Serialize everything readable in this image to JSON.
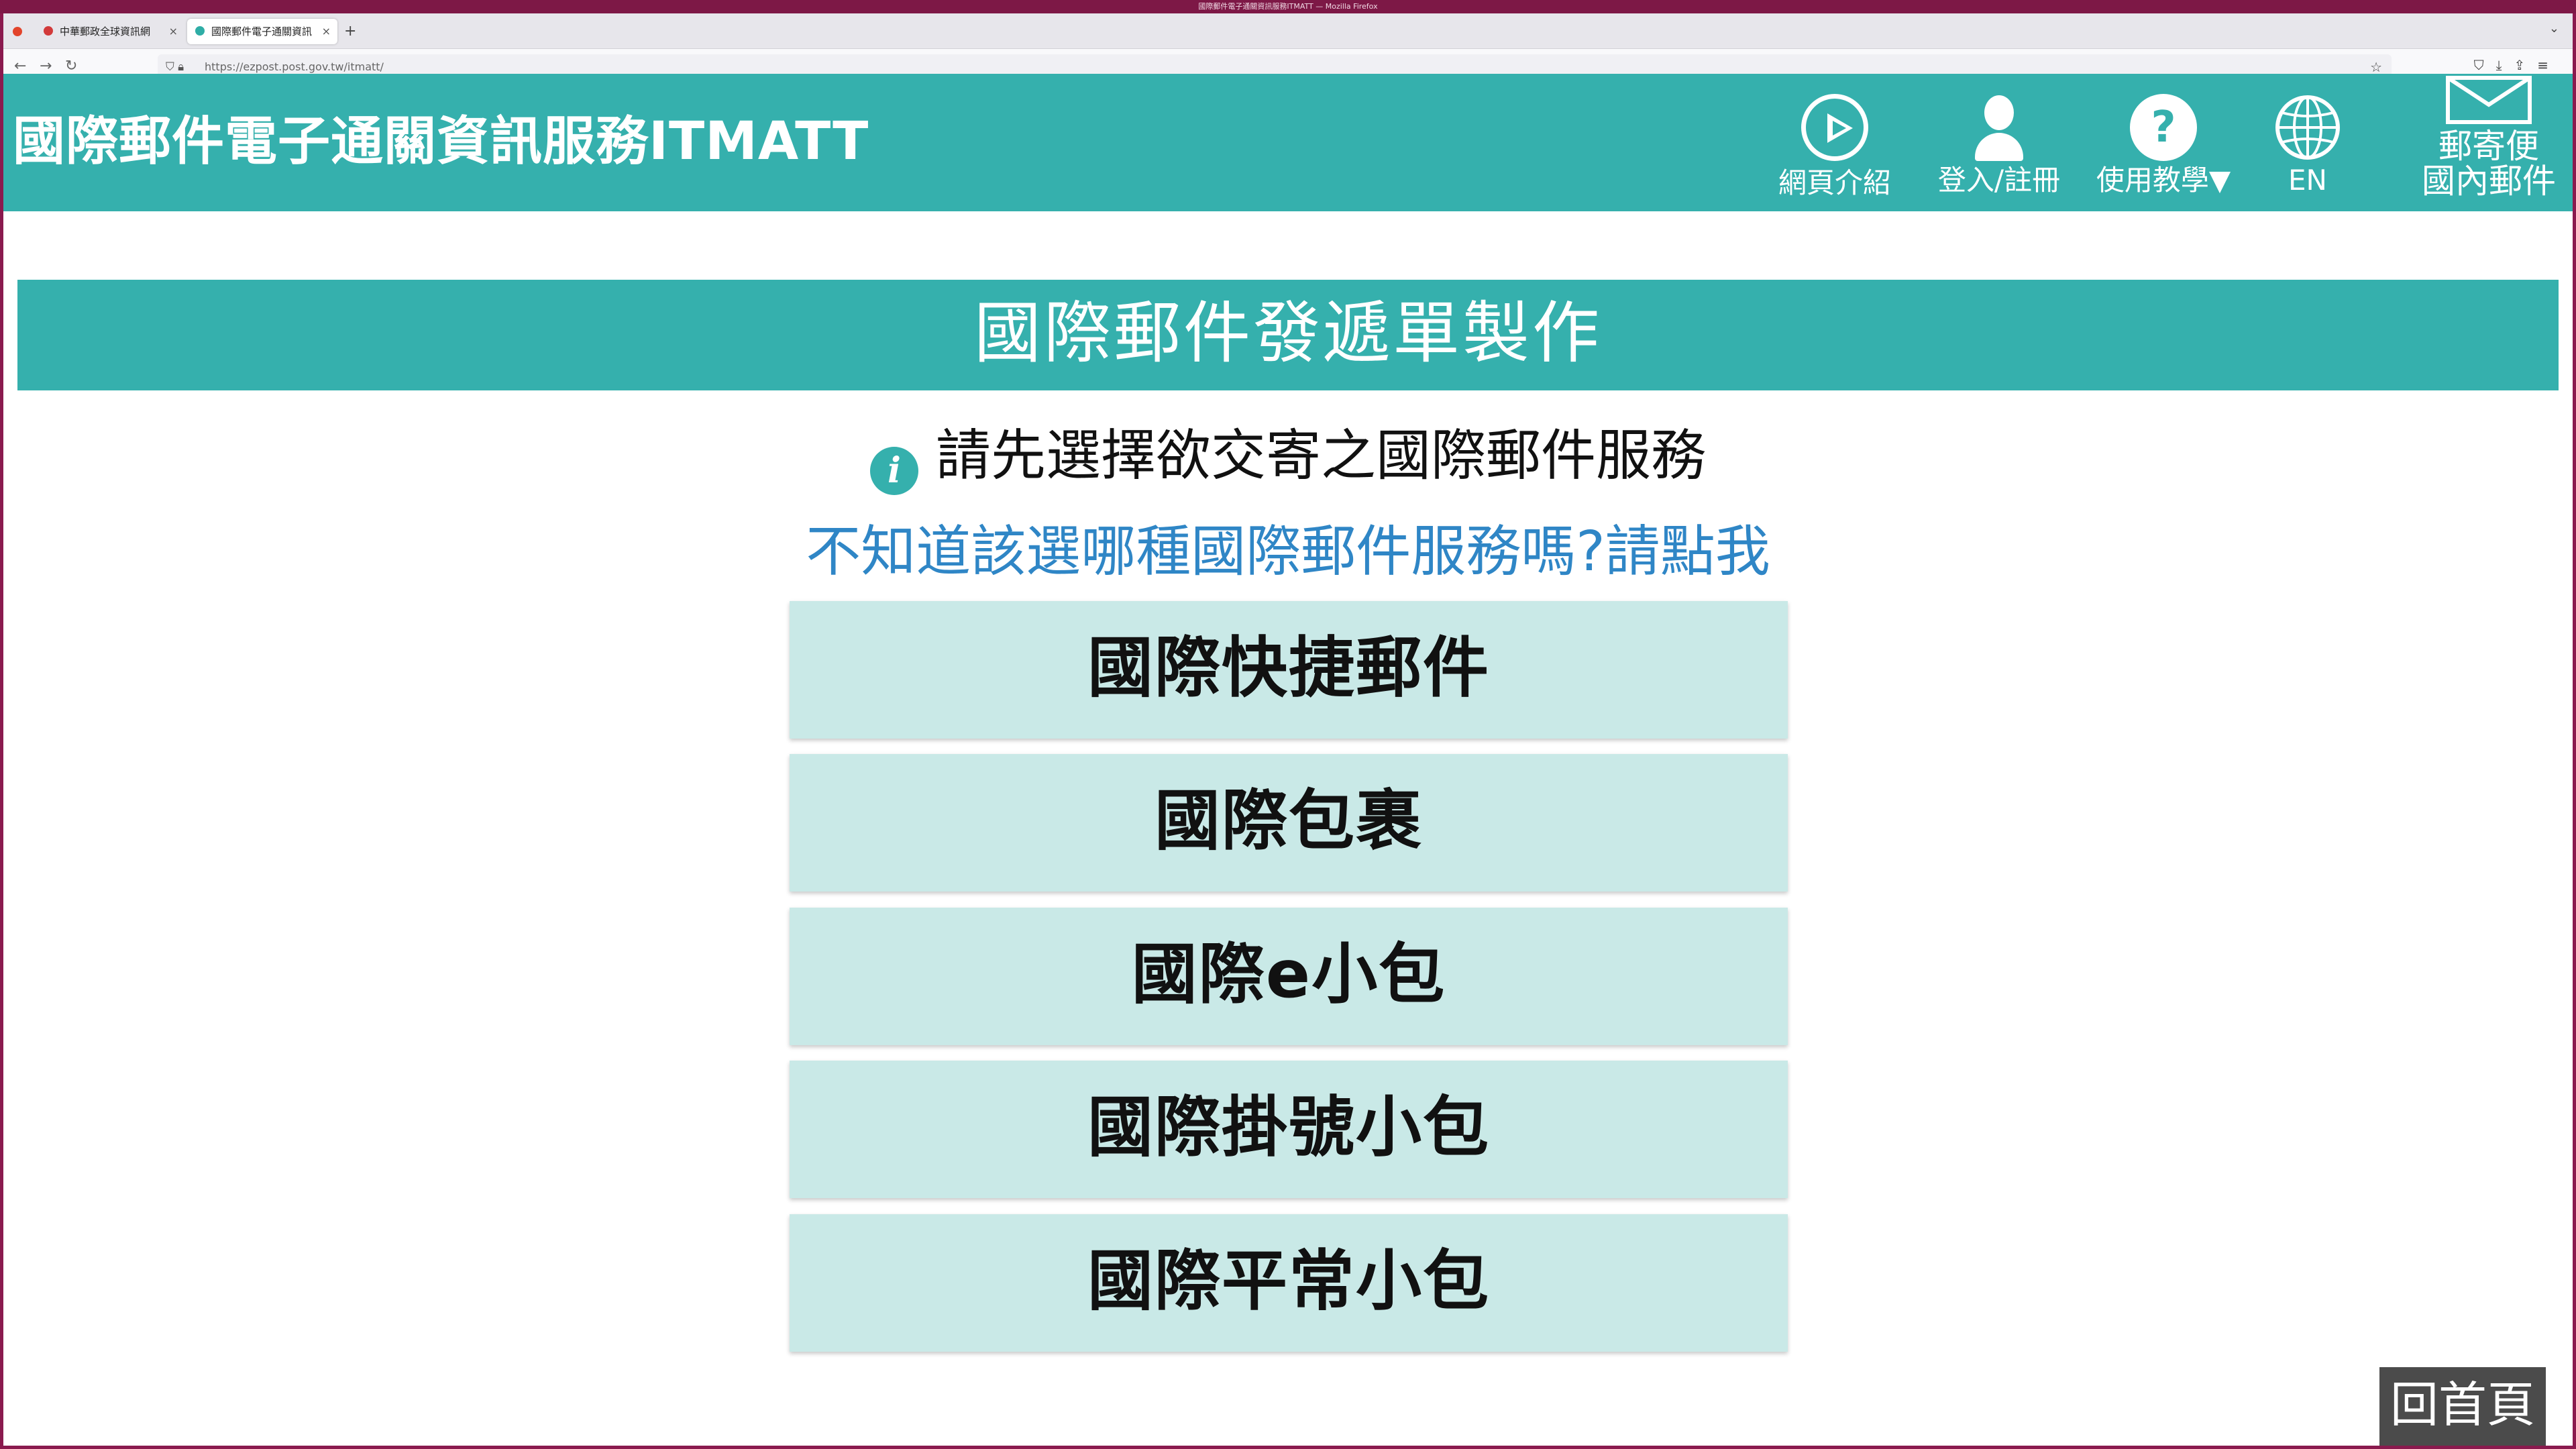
{
  "window": {
    "title": "國際郵件電子通關資訊服務ITMATT — Mozilla Firefox"
  },
  "browser": {
    "tabs": [
      {
        "label": "中華郵政全球資訊網",
        "active": false
      },
      {
        "label": "國際郵件電子通關資訊ITMATT",
        "active": true
      }
    ],
    "new_tab": "+",
    "close_glyph": "×",
    "url_host": "https://ezpost.post.gov.tw",
    "url_path": "/itmatt/",
    "nav": {
      "back": "←",
      "forward": "→",
      "reload": "↻"
    }
  },
  "header": {
    "title": "國際郵件電子通關資訊服務ITMATT",
    "nav": [
      {
        "label": "網頁介紹",
        "icon": "play-icon"
      },
      {
        "label": "登入/註冊",
        "icon": "user-icon"
      },
      {
        "label": "使用教學▼",
        "icon": "question-icon"
      },
      {
        "label": "EN",
        "icon": "globe-icon"
      },
      {
        "label_line1": "郵寄便",
        "label_line2": "國內郵件",
        "icon": "mail-icon"
      }
    ],
    "color": "#35b0ad"
  },
  "main": {
    "banner": "國際郵件發遞單製作",
    "instruction": "請先選擇欲交寄之國際郵件服務",
    "help_link": "不知道該選哪種國際郵件服務嗎?請點我",
    "services": [
      "國際快捷郵件",
      "國際包裹",
      "國際e小包",
      "國際掛號小包",
      "國際平常小包"
    ],
    "home_button": "回首頁"
  }
}
